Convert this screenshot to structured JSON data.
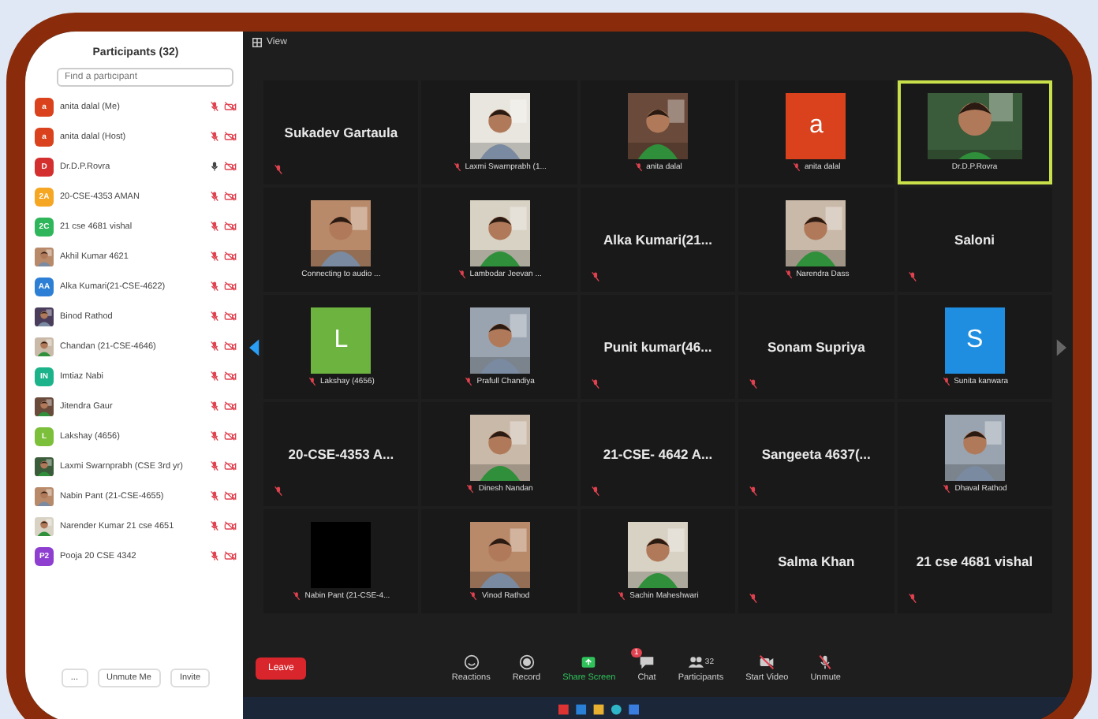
{
  "participants_panel": {
    "title": "Participants (32)",
    "search": {
      "placeholder": "Find a participant"
    },
    "items": [
      {
        "name": "anita dalal (Me)",
        "avatar": "a",
        "color": "#d9421c",
        "muted": true
      },
      {
        "name": "anita dalal (Host)",
        "avatar": "a",
        "color": "#d9421c",
        "muted": true
      },
      {
        "name": "Dr.D.P.Rovra",
        "avatar": "D",
        "color": "#d32f2f",
        "muted": false
      },
      {
        "name": "20-CSE-4353 AMAN",
        "avatar": "2A",
        "color": "#f5a623",
        "muted": true
      },
      {
        "name": "21 cse 4681 vishal",
        "avatar": "2C",
        "color": "#2fb55a",
        "muted": true
      },
      {
        "name": "Akhil Kumar 4621",
        "kind": "picture",
        "muted": true
      },
      {
        "name": "Alka Kumari(21-CSE-4622)",
        "avatar": "AA",
        "color": "#2d7fd6",
        "muted": true
      },
      {
        "name": "Binod Rathod",
        "kind": "picture",
        "muted": true
      },
      {
        "name": "Chandan (21-CSE-4646)",
        "kind": "picture",
        "muted": true
      },
      {
        "name": "Imtiaz Nabi",
        "avatar": "IN",
        "color": "#1db38a",
        "muted": true
      },
      {
        "name": "Jitendra Gaur",
        "kind": "picture",
        "muted": true
      },
      {
        "name": "Lakshay (4656)",
        "avatar": "L",
        "color": "#7cbf3a",
        "muted": true
      },
      {
        "name": "Laxmi Swarnprabh (CSE 3rd yr)",
        "kind": "picture",
        "muted": true
      },
      {
        "name": "Nabin Pant (21-CSE-4655)",
        "kind": "picture",
        "muted": true
      },
      {
        "name": "Narender Kumar 21 cse 4651",
        "kind": "picture",
        "muted": true
      },
      {
        "name": "Pooja 20 CSE 4342",
        "avatar": "P2",
        "color": "#8e3fd0",
        "muted": true
      }
    ],
    "footer_buttons": [
      "...",
      "Unmute Me",
      "Invite"
    ]
  },
  "top_bar": {
    "view_label": "View"
  },
  "tiles": [
    {
      "kind": "name",
      "name": "Sukadev Gartaula",
      "muted": true,
      "selected": false
    },
    {
      "caption": "Laxmi Swarnprabh (1...",
      "muted": true,
      "selected": false
    },
    {
      "caption": "anita dalal",
      "muted": true,
      "selected": false
    },
    {
      "kind": "initial",
      "initial": "a",
      "color": "#d9421c",
      "caption": "anita dalal",
      "muted": true,
      "selected": false
    },
    {
      "caption": "Dr.D.P.Rovra",
      "muted": false,
      "selected": true
    },
    {
      "caption": "Connecting to audio ...",
      "muted": false,
      "selected": false
    },
    {
      "caption": "Lambodar Jeevan ...",
      "muted": true,
      "selected": false
    },
    {
      "kind": "name",
      "name": "Alka Kumari(21...",
      "muted": true,
      "selected": false
    },
    {
      "caption": "Narendra Dass",
      "muted": true,
      "selected": false
    },
    {
      "kind": "name",
      "name": "Saloni",
      "muted": true,
      "selected": false
    },
    {
      "kind": "initial",
      "initial": "L",
      "color": "#6cb33f",
      "caption": "Lakshay (4656)",
      "muted": true,
      "selected": false
    },
    {
      "caption": "Prafull Chandiya",
      "muted": true,
      "selected": false
    },
    {
      "kind": "name",
      "name": "Punit kumar(46...",
      "muted": true,
      "selected": false
    },
    {
      "kind": "name",
      "name": "Sonam Supriya",
      "muted": true,
      "selected": false
    },
    {
      "kind": "initial",
      "initial": "S",
      "color": "#1f8ee0",
      "caption": "Sunita kanwara",
      "muted": true,
      "selected": false
    },
    {
      "kind": "name",
      "name": "20-CSE-4353 A...",
      "muted": true,
      "selected": false
    },
    {
      "caption": "Dinesh Nandan",
      "muted": true,
      "selected": false
    },
    {
      "kind": "name",
      "name": "21-CSE- 4642 A...",
      "muted": true,
      "selected": false
    },
    {
      "kind": "name",
      "name": "Sangeeta 4637(...",
      "muted": true,
      "selected": false
    },
    {
      "caption": "Dhaval Rathod",
      "muted": true,
      "selected": false
    },
    {
      "kind": "blank",
      "caption": "Nabin Pant (21-CSE-4...",
      "muted": true,
      "selected": false
    },
    {
      "caption": "Vinod Rathod",
      "muted": true,
      "selected": false
    },
    {
      "caption": "Sachin Maheshwari",
      "muted": true,
      "selected": false
    },
    {
      "kind": "name",
      "name": "Salma Khan",
      "muted": true,
      "selected": false
    },
    {
      "kind": "name",
      "name": "21 cse 4681 vishal",
      "muted": true,
      "selected": false
    }
  ],
  "toolbar": {
    "leave": "Leave",
    "items": [
      {
        "kind": "reactions",
        "label": "Reactions"
      },
      {
        "kind": "record",
        "label": "Record"
      },
      {
        "kind": "share",
        "label": "Share Screen"
      },
      {
        "kind": "chat",
        "label": "Chat",
        "badge": "1"
      },
      {
        "kind": "participants",
        "label": "Participants",
        "count": "32"
      },
      {
        "kind": "video",
        "label": "Start Video"
      },
      {
        "kind": "mic",
        "label": "Unmute"
      }
    ]
  }
}
